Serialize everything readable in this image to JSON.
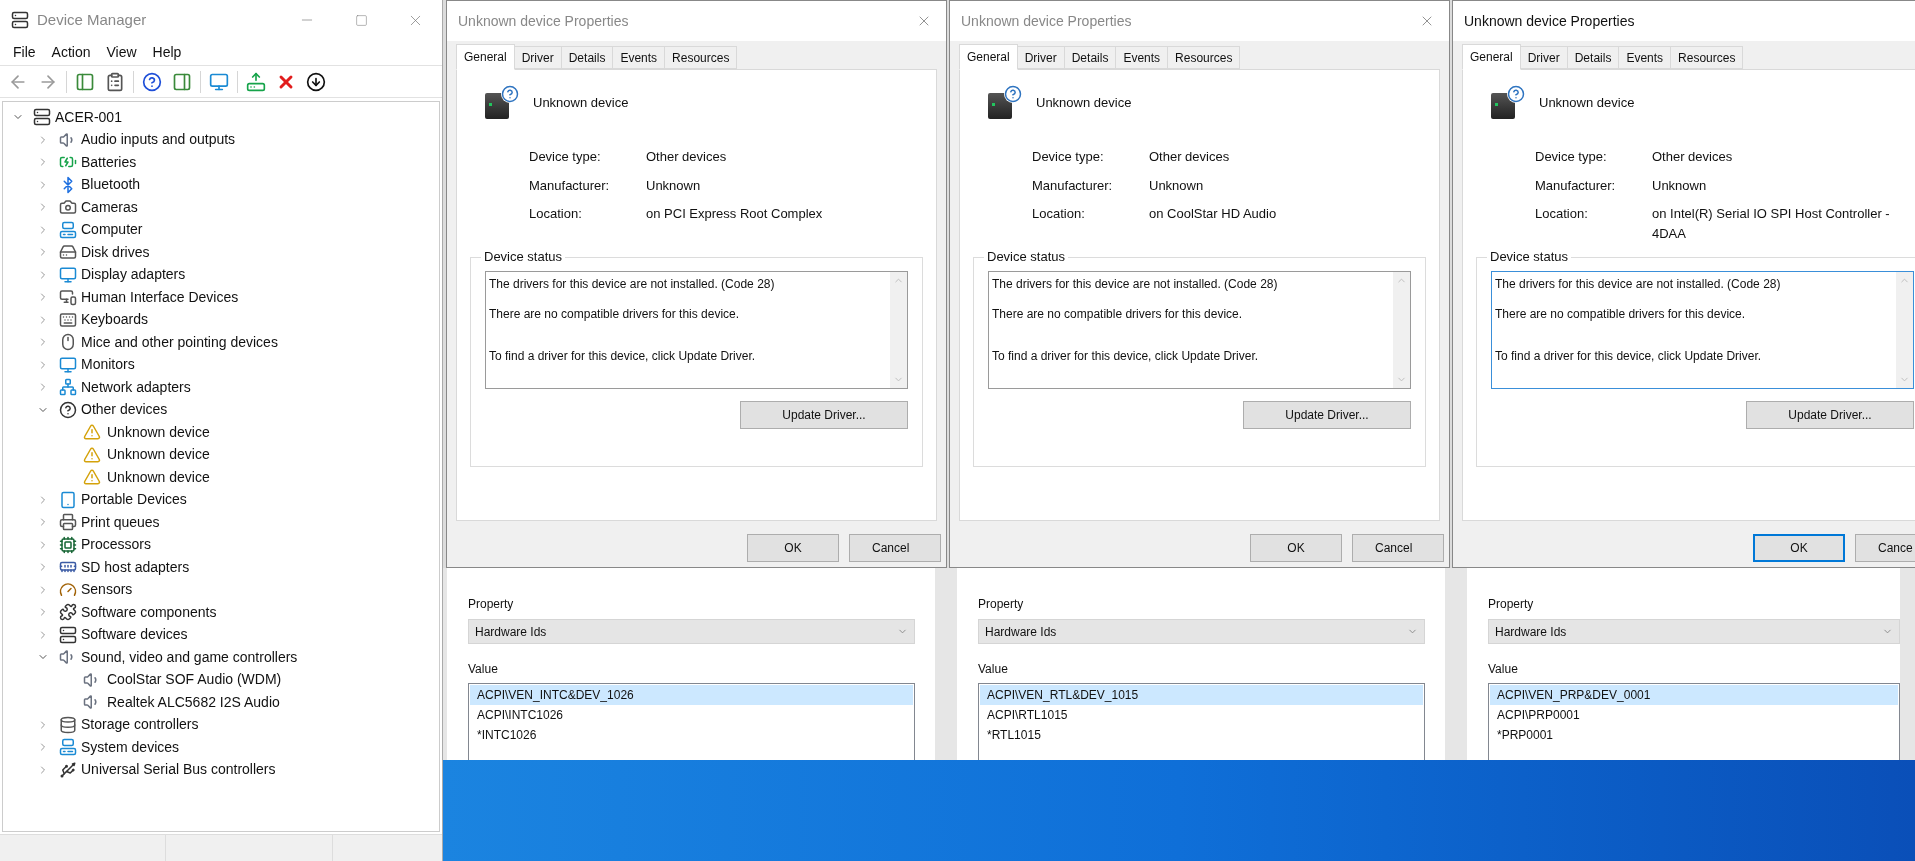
{
  "device_manager": {
    "title": "Device Manager",
    "menu": [
      "File",
      "Action",
      "View",
      "Help"
    ],
    "tree": {
      "label": "ACER-001",
      "expanded": true,
      "children": [
        {
          "label": "Audio inputs and outputs",
          "expanded": false
        },
        {
          "label": "Batteries",
          "expanded": false
        },
        {
          "label": "Bluetooth",
          "expanded": false
        },
        {
          "label": "Cameras",
          "expanded": false
        },
        {
          "label": "Computer",
          "expanded": false
        },
        {
          "label": "Disk drives",
          "expanded": false
        },
        {
          "label": "Display adapters",
          "expanded": false
        },
        {
          "label": "Human Interface Devices",
          "expanded": false
        },
        {
          "label": "Keyboards",
          "expanded": false
        },
        {
          "label": "Mice and other pointing devices",
          "expanded": false
        },
        {
          "label": "Monitors",
          "expanded": false
        },
        {
          "label": "Network adapters",
          "expanded": false
        },
        {
          "label": "Other devices",
          "expanded": true,
          "children": [
            {
              "label": "Unknown device"
            },
            {
              "label": "Unknown device"
            },
            {
              "label": "Unknown device"
            }
          ]
        },
        {
          "label": "Portable Devices",
          "expanded": false
        },
        {
          "label": "Print queues",
          "expanded": false
        },
        {
          "label": "Processors",
          "expanded": false
        },
        {
          "label": "SD host adapters",
          "expanded": false
        },
        {
          "label": "Sensors",
          "expanded": false
        },
        {
          "label": "Software components",
          "expanded": false
        },
        {
          "label": "Software devices",
          "expanded": false
        },
        {
          "label": "Sound, video and game controllers",
          "expanded": true,
          "children": [
            {
              "label": "CoolStar SOF Audio (WDM)"
            },
            {
              "label": "Realtek ALC5682 I2S Audio"
            }
          ]
        },
        {
          "label": "Storage controllers",
          "expanded": false
        },
        {
          "label": "System devices",
          "expanded": false
        },
        {
          "label": "Universal Serial Bus controllers",
          "expanded": false
        }
      ]
    }
  },
  "dialogs": [
    {
      "title": "Unknown device Properties",
      "active": false,
      "tabs": [
        {
          "label": "General",
          "selected": true
        },
        {
          "label": "Driver",
          "selected": false
        },
        {
          "label": "Details",
          "selected": false
        },
        {
          "label": "Events",
          "selected": false
        },
        {
          "label": "Resources",
          "selected": false
        }
      ],
      "device_name": "Unknown device",
      "fields": [
        {
          "label": "Device type:",
          "value": "Other devices"
        },
        {
          "label": "Manufacturer:",
          "value": "Unknown"
        },
        {
          "label": "Location:",
          "value": "on PCI Express Root Complex"
        }
      ],
      "status_title": "Device status",
      "status_focused": false,
      "status_lines": [
        "The drivers for this device are not installed. (Code 28)",
        "There are no compatible drivers for this device.",
        "To find a driver for this device, click Update Driver."
      ],
      "update_button": "Update Driver...",
      "buttons": [
        {
          "label": "OK",
          "default": false
        },
        {
          "label": "Cancel",
          "default": false
        }
      ]
    },
    {
      "title": "Unknown device Properties",
      "active": false,
      "tabs": [
        {
          "label": "General",
          "selected": true
        },
        {
          "label": "Driver",
          "selected": false
        },
        {
          "label": "Details",
          "selected": false
        },
        {
          "label": "Events",
          "selected": false
        },
        {
          "label": "Resources",
          "selected": false
        }
      ],
      "device_name": "Unknown device",
      "fields": [
        {
          "label": "Device type:",
          "value": "Other devices"
        },
        {
          "label": "Manufacturer:",
          "value": "Unknown"
        },
        {
          "label": "Location:",
          "value": "on CoolStar HD Audio"
        }
      ],
      "status_title": "Device status",
      "status_focused": false,
      "status_lines": [
        "The drivers for this device are not installed. (Code 28)",
        "There are no compatible drivers for this device.",
        "To find a driver for this device, click Update Driver."
      ],
      "update_button": "Update Driver...",
      "buttons": [
        {
          "label": "OK",
          "default": false
        },
        {
          "label": "Cancel",
          "default": false
        }
      ]
    },
    {
      "title": "Unknown device Properties",
      "active": true,
      "tabs": [
        {
          "label": "General",
          "selected": true
        },
        {
          "label": "Driver",
          "selected": false
        },
        {
          "label": "Details",
          "selected": false
        },
        {
          "label": "Events",
          "selected": false
        },
        {
          "label": "Resources",
          "selected": false
        }
      ],
      "device_name": "Unknown device",
      "fields": [
        {
          "label": "Device type:",
          "value": "Other devices"
        },
        {
          "label": "Manufacturer:",
          "value": "Unknown"
        },
        {
          "label": "Location:",
          "value": "on Intel(R) Serial IO SPI Host Controller - 4DAA"
        }
      ],
      "status_title": "Device status",
      "status_focused": true,
      "status_lines": [
        "The drivers for this device are not installed. (Code 28)",
        "There are no compatible drivers for this device.",
        "To find a driver for this device, click Update Driver."
      ],
      "update_button": "Update Driver...",
      "buttons": [
        {
          "label": "OK",
          "default": true
        },
        {
          "label": "Cance",
          "default": false
        }
      ]
    }
  ],
  "details_panes": [
    {
      "property_label": "Property",
      "property_value": "Hardware Ids",
      "value_label": "Value",
      "values": [
        {
          "text": "ACPI\\VEN_INTC&DEV_1026",
          "selected": true
        },
        {
          "text": "ACPI\\INTC1026",
          "selected": false
        },
        {
          "text": "*INTC1026",
          "selected": false
        }
      ]
    },
    {
      "property_label": "Property",
      "property_value": "Hardware Ids",
      "value_label": "Value",
      "values": [
        {
          "text": "ACPI\\VEN_RTL&DEV_1015",
          "selected": true
        },
        {
          "text": "ACPI\\RTL1015",
          "selected": false
        },
        {
          "text": "*RTL1015",
          "selected": false
        }
      ]
    },
    {
      "property_label": "Property",
      "property_value": "Hardware Ids",
      "value_label": "Value",
      "values": [
        {
          "text": "ACPI\\VEN_PRP&DEV_0001",
          "selected": true
        },
        {
          "text": "ACPI\\PRP0001",
          "selected": false
        },
        {
          "text": "*PRP0001",
          "selected": false
        }
      ]
    }
  ]
}
